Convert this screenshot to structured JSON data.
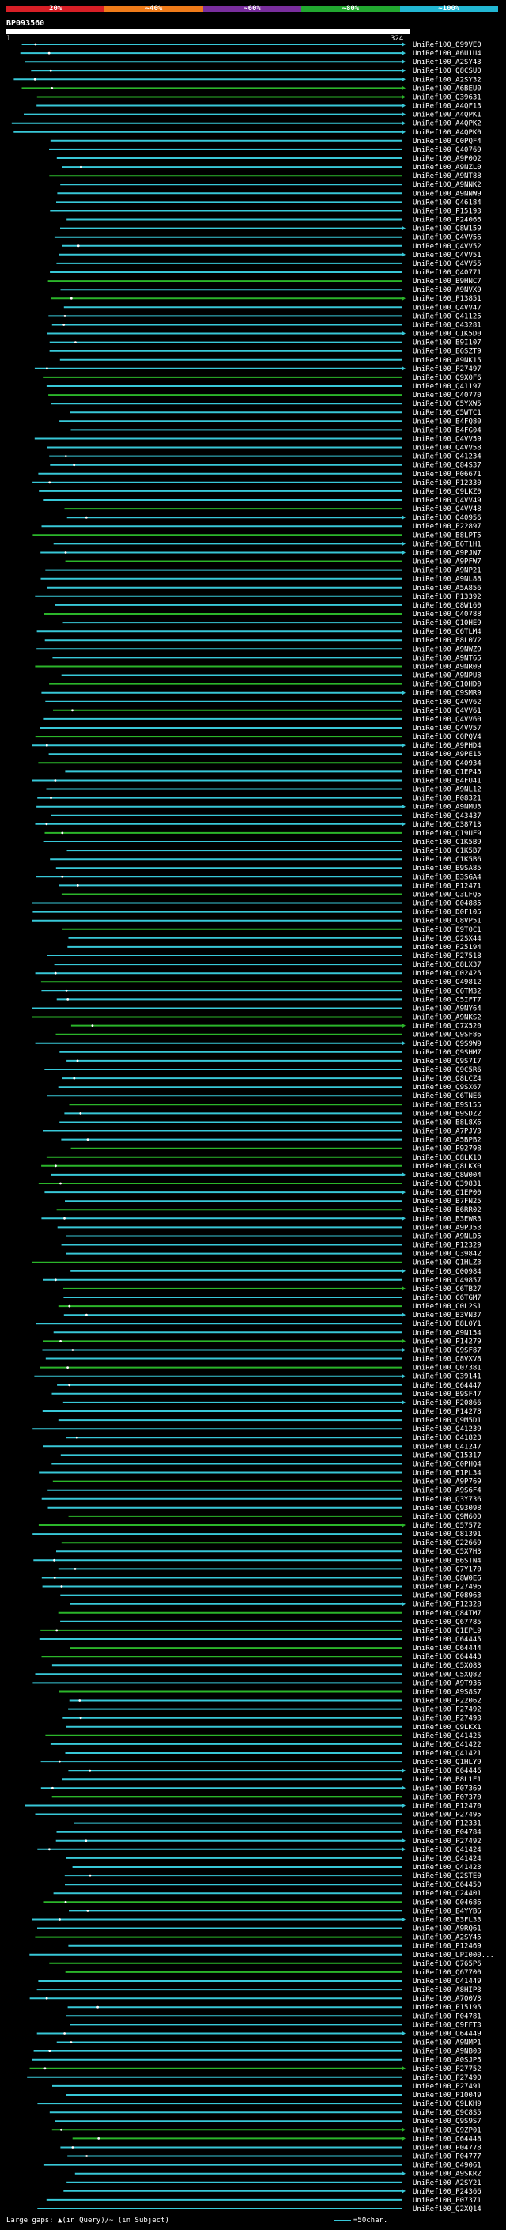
{
  "scale": {
    "labels": [
      "20%",
      "~40%",
      "~60%",
      "~80%",
      "~100%"
    ],
    "colors": [
      "#d81f26",
      "#f07c1a",
      "#7a2e9e",
      "#22a830",
      "#22b7d3"
    ]
  },
  "query": {
    "id": "BP093560",
    "start": "1",
    "end": "324"
  },
  "colors": {
    "high": "#38c8d8",
    "mid": "#2bb52a",
    "gap": "#ffffff"
  },
  "hits": [
    "UniRef100_Q99VE0",
    "UniRef100_A6U1U4",
    "UniRef100_A2SY43",
    "UniRef100_Q8CSU0",
    "UniRef100_A2SY32",
    "UniRef100_A6BEU0",
    "UniRef100_Q39631",
    "UniRef100_A4QF13",
    "UniRef100_A4QPK1",
    "UniRef100_A4QPK2",
    "UniRef100_A4QPK0",
    "UniRef100_C0PQF4",
    "UniRef100_Q40769",
    "UniRef100_A9P0Q2",
    "UniRef100_A9NZL0",
    "UniRef100_A9NT88",
    "UniRef100_A9NNK2",
    "UniRef100_A9NNW9",
    "UniRef100_Q46184",
    "UniRef100_P15193",
    "UniRef100_P24066",
    "UniRef100_Q8W159",
    "UniRef100_Q4VV56",
    "UniRef100_Q4VV52",
    "UniRef100_Q4VV51",
    "UniRef100_Q4VV55",
    "UniRef100_Q40771",
    "UniRef100_B9HNC7",
    "UniRef100_A9NVX9",
    "UniRef100_P13851",
    "UniRef100_Q4VV47",
    "UniRef100_Q41125",
    "UniRef100_Q43281",
    "UniRef100_C1K5D0",
    "UniRef100_B9I107",
    "UniRef100_B6SZT9",
    "UniRef100_A9NK15",
    "UniRef100_P27497",
    "UniRef100_Q9X0F6",
    "UniRef100_Q41197",
    "UniRef100_Q40770",
    "UniRef100_C5YXW5",
    "UniRef100_C5WTC1",
    "UniRef100_B4FQ80",
    "UniRef100_B4FG04",
    "UniRef100_Q4VV59",
    "UniRef100_Q4VV58",
    "UniRef100_Q41234",
    "UniRef100_Q84S37",
    "UniRef100_P06671",
    "UniRef100_P12330",
    "UniRef100_Q9LKZ0",
    "UniRef100_Q4VV49",
    "UniRef100_Q4VV48",
    "UniRef100_Q40956",
    "UniRef100_P22897",
    "UniRef100_B8LPT5",
    "UniRef100_B6T1H1",
    "UniRef100_A9PJN7",
    "UniRef100_A9PFW7",
    "UniRef100_A9NP21",
    "UniRef100_A9NL88",
    "UniRef100_A5A856",
    "UniRef100_P13392",
    "UniRef100_Q8W160",
    "UniRef100_Q40788",
    "UniRef100_Q10HE9",
    "UniRef100_C6TLM4",
    "UniRef100_B8L0V2",
    "UniRef100_A9NWZ9",
    "UniRef100_A9NT65",
    "UniRef100_A9NR09",
    "UniRef100_A9NPU8",
    "UniRef100_Q10HD0",
    "UniRef100_Q9SMR9",
    "UniRef100_Q4VV62",
    "UniRef100_Q4VV61",
    "UniRef100_Q4VV60",
    "UniRef100_Q4VV57",
    "UniRef100_C0PQV4",
    "UniRef100_A9PHD4",
    "UniRef100_A9PE15",
    "UniRef100_Q40934",
    "UniRef100_Q1EP45",
    "UniRef100_B4FU41",
    "UniRef100_A9NL12",
    "UniRef100_P08321",
    "UniRef100_A9NMU3",
    "UniRef100_Q43437",
    "UniRef100_Q38713",
    "UniRef100_Q19UF9",
    "UniRef100_C1K5B9",
    "UniRef100_C1K5B7",
    "UniRef100_C1K5B6",
    "UniRef100_B9SA85",
    "UniRef100_B3SGA4",
    "UniRef100_P12471",
    "UniRef100_Q3LFQ5",
    "UniRef100_O04885",
    "UniRef100_D0F105",
    "UniRef100_C8VP51",
    "UniRef100_B9T0C1",
    "UniRef100_Q2SX44",
    "UniRef100_P25194",
    "UniRef100_P27518",
    "UniRef100_Q8LX37",
    "UniRef100_O02425",
    "UniRef100_O49812",
    "UniRef100_C6TM32",
    "UniRef100_C5IFT7",
    "UniRef100_A9NY64",
    "UniRef100_A9NKS2",
    "UniRef100_Q7X520",
    "UniRef100_Q9SF86",
    "UniRef100_Q9S9W9",
    "UniRef100_Q9SHM7",
    "UniRef100_Q9S7I7",
    "UniRef100_Q9C5R6",
    "UniRef100_Q8LCZ4",
    "UniRef100_Q9SX67",
    "UniRef100_C6TNE6",
    "UniRef100_B9S155",
    "UniRef100_B9SDZ2",
    "UniRef100_B8L8X6",
    "UniRef100_A7PJV3",
    "UniRef100_A5BPB2",
    "UniRef100_P92798",
    "UniRef100_Q8LK10",
    "UniRef100_Q8LKX0",
    "UniRef100_Q8W004",
    "UniRef100_Q39831",
    "UniRef100_Q1EP00",
    "UniRef100_B7FN25",
    "UniRef100_B6RR02",
    "UniRef100_B3EWR3",
    "UniRef100_A9PJ53",
    "UniRef100_A9NLD5",
    "UniRef100_P12329",
    "UniRef100_Q39842",
    "UniRef100_Q1HLZ3",
    "UniRef100_Q00984",
    "UniRef100_O49857",
    "UniRef100_C6TB27",
    "UniRef100_C6TGM7",
    "UniRef100_C0L2S1",
    "UniRef100_B3VN37",
    "UniRef100_B8L0Y1",
    "UniRef100_A9N154",
    "UniRef100_P14279",
    "UniRef100_Q9SF87",
    "UniRef100_Q8VXV8",
    "UniRef100_Q07381",
    "UniRef100_Q39141",
    "UniRef100_O64447",
    "UniRef100_B9SF47",
    "UniRef100_P20866",
    "UniRef100_P14278",
    "UniRef100_Q9M5D1",
    "UniRef100_Q41239",
    "UniRef100_O41823",
    "UniRef100_O41247",
    "UniRef100_Q15317",
    "UniRef100_C0PHQ4",
    "UniRef100_B1PL34",
    "UniRef100_A9P769",
    "UniRef100_A9S6F4",
    "UniRef100_Q3Y736",
    "UniRef100_Q93098",
    "UniRef100_Q9M600",
    "UniRef100_Q57572",
    "UniRef100_O81391",
    "UniRef100_O22669",
    "UniRef100_C5X7H3",
    "UniRef100_B6STN4",
    "UniRef100_Q7Y170",
    "UniRef100_Q8W0E6",
    "UniRef100_P27496",
    "UniRef100_P08963",
    "UniRef100_P12328",
    "UniRef100_Q84TM7",
    "UniRef100_Q67785",
    "UniRef100_Q1EPL9",
    "UniRef100_O64445",
    "UniRef100_O64444",
    "UniRef100_O64443",
    "UniRef100_C5XQ83",
    "UniRef100_C5XQ82",
    "UniRef100_A9T936",
    "UniRef100_A9S8S7",
    "UniRef100_P22062",
    "UniRef100_P27492",
    "UniRef100_P27493",
    "UniRef100_Q9LKX1",
    "UniRef100_Q41425",
    "UniRef100_Q41422",
    "UniRef100_Q41421",
    "UniRef100_Q1HLY9",
    "UniRef100_O64446",
    "UniRef100_B8L1F1",
    "UniRef100_P07369",
    "UniRef100_P07370",
    "UniRef100_P12470",
    "UniRef100_P27495",
    "UniRef100_P12331",
    "UniRef100_P04784",
    "UniRef100_P27492",
    "UniRef100_Q41424",
    "UniRef100_Q41424",
    "UniRef100_Q41423",
    "UniRef100_Q2STE0",
    "UniRef100_O64450",
    "UniRef100_O24401",
    "UniRef100_O04686",
    "UniRef100_B4YYB6",
    "UniRef100_B3FL33",
    "UniRef100_A9RQ61",
    "UniRef100_A2SY45",
    "UniRef100_P12469",
    "UniRef100_UPI000...",
    "UniRef100_Q765P6",
    "UniRef100_Q67700",
    "UniRef100_O41449",
    "UniRef100_A8HIP3",
    "UniRef100_A7Q0V3",
    "UniRef100_P15195",
    "UniRef100_P04781",
    "UniRef100_Q9FFT3",
    "UniRef100_O64449",
    "UniRef100_A9NMP1",
    "UniRef100_A9NB03",
    "UniRef100_A0SJP5",
    "UniRef100_P27752",
    "UniRef100_P27490",
    "UniRef100_P27491",
    "UniRef100_P10049",
    "UniRef100_Q9LKH9",
    "UniRef100_Q9C8S5",
    "UniRef100_Q9S9S7",
    "UniRef100_Q9ZP01",
    "UniRef100_O64448",
    "UniRef100_P04778",
    "UniRef100_P04777",
    "UniRef100_O49061",
    "UniRef100_A9SKR2",
    "UniRef100_A2SY21",
    "UniRef100_P24366",
    "UniRef100_P07371",
    "UniRef100_Q2XQ14"
  ]
}
